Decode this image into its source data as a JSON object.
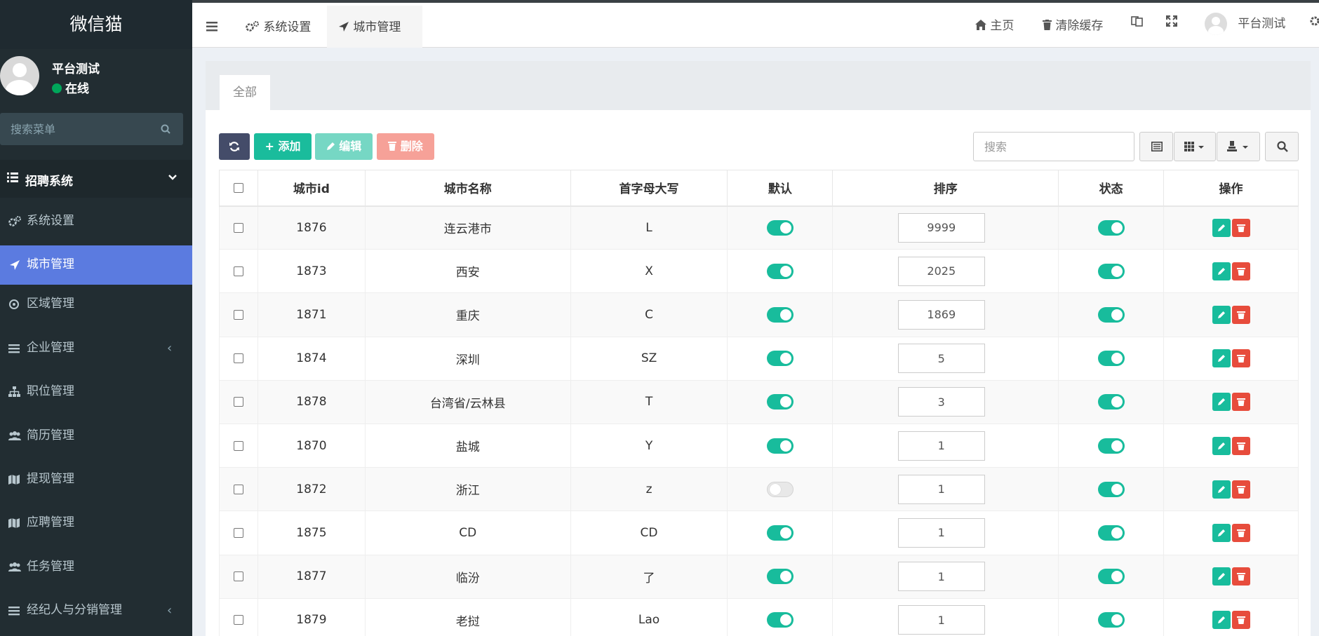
{
  "brand": "微信猫",
  "user": {
    "name": "平台测试",
    "status": "在线"
  },
  "menu_search_placeholder": "搜索菜单",
  "menu_header": "招聘系统",
  "menu": [
    {
      "label": "系统设置",
      "icon": "gears-icon"
    },
    {
      "label": "城市管理",
      "icon": "location-arrow-icon",
      "active": true
    },
    {
      "label": "区域管理",
      "icon": "compass-icon"
    },
    {
      "label": "企业管理",
      "icon": "list-icon",
      "expandable": true
    },
    {
      "label": "职位管理",
      "icon": "sitemap-icon"
    },
    {
      "label": "简历管理",
      "icon": "users-icon"
    },
    {
      "label": "提现管理",
      "icon": "map-icon"
    },
    {
      "label": "应聘管理",
      "icon": "map-icon"
    },
    {
      "label": "任务管理",
      "icon": "users-icon"
    },
    {
      "label": "经纪人与分销管理",
      "icon": "list-icon",
      "expandable": true
    }
  ],
  "top_tabs": [
    "系统设置",
    "城市管理"
  ],
  "top_right": {
    "home": "主页",
    "clear_cache": "清除缓存",
    "user": "平台测试"
  },
  "panel_tab": "全部",
  "toolbar": {
    "add": "添加",
    "edit": "编辑",
    "delete": "删除",
    "search_placeholder": "搜索"
  },
  "columns": [
    "城市id",
    "城市名称",
    "首字母大写",
    "默认",
    "排序",
    "状态",
    "操作"
  ],
  "rows": [
    {
      "id": "1876",
      "name": "连云港市",
      "initial": "L",
      "default": true,
      "sort": "9999",
      "status": true
    },
    {
      "id": "1873",
      "name": "西安",
      "initial": "X",
      "default": true,
      "sort": "2025",
      "status": true
    },
    {
      "id": "1871",
      "name": "重庆",
      "initial": "C",
      "default": true,
      "sort": "1869",
      "status": true
    },
    {
      "id": "1874",
      "name": "深圳",
      "initial": "SZ",
      "default": true,
      "sort": "5",
      "status": true
    },
    {
      "id": "1878",
      "name": "台湾省/云林县",
      "initial": "T",
      "default": true,
      "sort": "3",
      "status": true
    },
    {
      "id": "1870",
      "name": "盐城",
      "initial": "Y",
      "default": true,
      "sort": "1",
      "status": true
    },
    {
      "id": "1872",
      "name": "浙江",
      "initial": "z",
      "default": false,
      "sort": "1",
      "status": true
    },
    {
      "id": "1875",
      "name": "CD",
      "initial": "CD",
      "default": true,
      "sort": "1",
      "status": true
    },
    {
      "id": "1877",
      "name": "临汾",
      "initial": "了",
      "default": true,
      "sort": "1",
      "status": true
    },
    {
      "id": "1879",
      "name": "老挝",
      "initial": "Lao",
      "default": true,
      "sort": "1",
      "status": true
    }
  ],
  "colors": {
    "sidebar": "#222d32",
    "active": "#5b7be0",
    "success": "#18bc9c",
    "danger": "#e74c3c"
  }
}
